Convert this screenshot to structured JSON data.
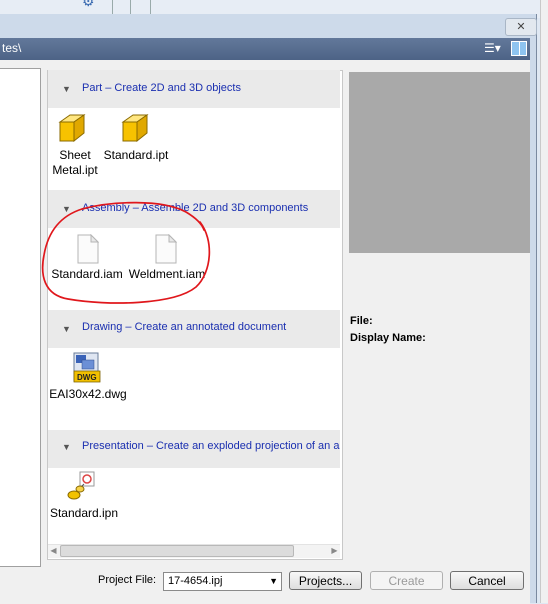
{
  "dialog": {
    "close_icon": "close-icon",
    "path_text": "tes\\",
    "view_menu_icon": "list-view-icon",
    "pane_icon": "preview-pane-icon"
  },
  "groups": [
    {
      "title": "Part – Create 2D and 3D objects",
      "items": [
        {
          "label1": "Sheet",
          "label2": "Metal.ipt",
          "icon": "part-cube-icon"
        },
        {
          "label1": "Standard.ipt",
          "label2": "",
          "icon": "part-cube-icon"
        }
      ]
    },
    {
      "title": "Assembly – Assemble 2D and 3D components",
      "items": [
        {
          "label1": "Standard.iam",
          "label2": "",
          "icon": "document-icon"
        },
        {
          "label1": "Weldment.iam",
          "label2": "",
          "icon": "document-icon"
        }
      ]
    },
    {
      "title": "Drawing – Create an annotated document",
      "items": [
        {
          "label1": "EAI30x42.dwg",
          "label2": "",
          "icon": "dwg-icon"
        }
      ]
    },
    {
      "title": "Presentation – Create an exploded projection of an as",
      "items": [
        {
          "label1": "Standard.ipn",
          "label2": "",
          "icon": "presentation-icon"
        }
      ]
    }
  ],
  "preview": {
    "file_label": "File:",
    "display_name_label": "Display Name:"
  },
  "footer": {
    "project_file_label": "Project File:",
    "project_file_value": "17-4654.ipj",
    "projects_button": "Projects...",
    "create_button": "Create",
    "cancel_button": "Cancel"
  },
  "colors": {
    "accent_title": "#1a2fb0",
    "path_bar": "#5a7095",
    "preview_bg": "#a9a9a9",
    "annotation": "#e0171c"
  }
}
